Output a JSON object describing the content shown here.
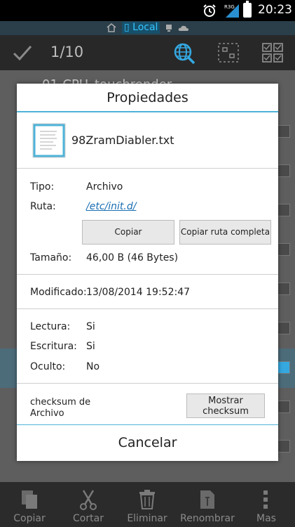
{
  "status": {
    "time": "20:23",
    "network": "R3G"
  },
  "location": {
    "label": "Local"
  },
  "toolbar": {
    "counter": "1/10"
  },
  "background": {
    "first_item": "01-CPU_touchrender"
  },
  "dialog": {
    "title": "Propiedades",
    "file_name": "98ZramDiablerTxt",
    "file_name_display": "98ZramDiabler.txt",
    "type_label": "Tipo:",
    "type_value": "Archivo",
    "path_label": "Ruta:",
    "path_value": "/etc/init.d/",
    "copy_button": "Copiar",
    "copy_full_button": "Copiar ruta completa",
    "size_label": "Tamaño:",
    "size_value": "46,00 B (46 Bytes)",
    "modified_label": "Modificado:",
    "modified_value": "13/08/2014 19:52:47",
    "read_label": "Lectura:",
    "read_value": "Si",
    "write_label": "Escritura:",
    "write_value": "Si",
    "hidden_label": "Oculto:",
    "hidden_value": "No",
    "checksum_label": "checksum de Archivo",
    "checksum_button": "Mostrar checksum",
    "cancel_button": "Cancelar"
  },
  "bottom_bar": {
    "items": [
      {
        "label": "Copiar",
        "icon": "copy-icon"
      },
      {
        "label": "Cortar",
        "icon": "scissors-icon"
      },
      {
        "label": "Eliminar",
        "icon": "trash-icon"
      },
      {
        "label": "Renombrar",
        "icon": "rename-icon"
      },
      {
        "label": "Mas",
        "icon": "more-icon"
      }
    ]
  },
  "colors": {
    "accent": "#4fb3d8",
    "link": "#1a6fb3",
    "local_highlight": "#35c4ff"
  }
}
